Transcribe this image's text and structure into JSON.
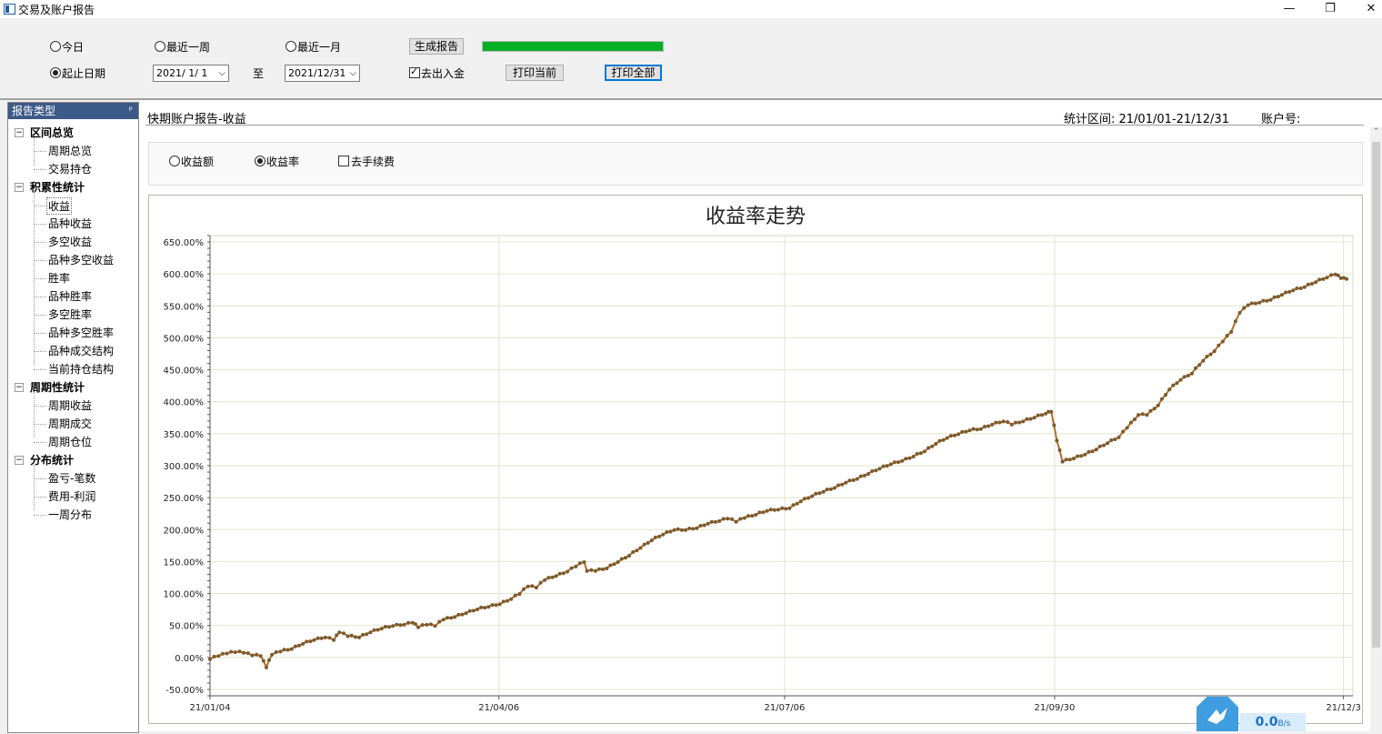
{
  "window": {
    "title": "交易及账户报告",
    "controls": {
      "minimize": "—",
      "restore": "❐",
      "close": "✕"
    }
  },
  "toolbar": {
    "range_today": "今日",
    "range_week": "最近一周",
    "range_month": "最近一月",
    "range_custom": "起止日期",
    "selected_range": "起止日期",
    "start_date": "2021/ 1/ 1",
    "to_label": "至",
    "end_date": "2021/12/31",
    "generate_label": "生成报告",
    "remove_deposit_label": "去出入金",
    "remove_deposit_checked": true,
    "print_current_label": "打印当前",
    "print_all_label": "打印全部",
    "progress": 1.0
  },
  "tree": {
    "header": "报告类型",
    "pin": "ᵖ",
    "groups": [
      {
        "label": "区间总览",
        "items": [
          "周期总览",
          "交易持仓"
        ]
      },
      {
        "label": "积累性统计",
        "items": [
          "收益",
          "品种收益",
          "多空收益",
          "品种多空收益",
          "胜率",
          "品种胜率",
          "多空胜率",
          "品种多空胜率",
          "品种成交结构",
          "当前持仓结构"
        ]
      },
      {
        "label": "周期性统计",
        "items": [
          "周期收益",
          "周期成交",
          "周期仓位"
        ]
      },
      {
        "label": "分布统计",
        "items": [
          "盈亏-笔数",
          "费用-利润",
          "一周分布"
        ]
      }
    ],
    "selected": "收益"
  },
  "report": {
    "title": "快期账户报告-收益",
    "period": "统计区间: 21/01/01-21/12/31",
    "account": "账户号:",
    "opt_amount": "收益额",
    "opt_rate": "收益率",
    "opt_fee": "去手续费",
    "selected_option": "收益率",
    "fee_checked": false
  },
  "net": {
    "speed": "0.0",
    "unit": "B/s"
  },
  "chart_data": {
    "type": "line",
    "title": "收益率走势",
    "ylim": [
      -60,
      660
    ],
    "yticks": [
      "650.00%",
      "600.00%",
      "550.00%",
      "500.00%",
      "450.00%",
      "400.00%",
      "350.00%",
      "300.00%",
      "250.00%",
      "200.00%",
      "150.00%",
      "100.00%",
      "50.00%",
      "0.00%",
      "-50.00%"
    ],
    "ytick_values": [
      650,
      600,
      550,
      500,
      450,
      400,
      350,
      300,
      250,
      200,
      150,
      100,
      50,
      0,
      -50
    ],
    "xticks": [
      "21/01/04",
      "21/04/06",
      "21/07/06",
      "21/09/30",
      "21/12/3"
    ],
    "xtick_days": [
      3,
      95,
      186,
      272,
      364
    ],
    "xlim": [
      3,
      367
    ],
    "grid": true,
    "line_color": "#b06d2f",
    "marker_color": "#7d5a2c",
    "series": [
      {
        "values_anchor": [
          [
            3,
            -2
          ],
          [
            6,
            3
          ],
          [
            9,
            7
          ],
          [
            12,
            9
          ],
          [
            15,
            8
          ],
          [
            18,
            4
          ],
          [
            21,
            3
          ],
          [
            23,
            -15
          ],
          [
            25,
            5
          ],
          [
            28,
            10
          ],
          [
            32,
            14
          ],
          [
            36,
            22
          ],
          [
            40,
            28
          ],
          [
            44,
            32
          ],
          [
            47,
            28
          ],
          [
            49,
            40
          ],
          [
            52,
            34
          ],
          [
            56,
            32
          ],
          [
            60,
            40
          ],
          [
            64,
            46
          ],
          [
            68,
            50
          ],
          [
            72,
            52
          ],
          [
            75,
            55
          ],
          [
            77,
            48
          ],
          [
            80,
            52
          ],
          [
            83,
            50
          ],
          [
            86,
            60
          ],
          [
            90,
            64
          ],
          [
            94,
            70
          ],
          [
            98,
            76
          ],
          [
            102,
            80
          ],
          [
            106,
            84
          ],
          [
            110,
            92
          ],
          [
            113,
            100
          ],
          [
            116,
            112
          ],
          [
            119,
            110
          ],
          [
            122,
            122
          ],
          [
            126,
            128
          ],
          [
            130,
            135
          ],
          [
            133,
            143
          ],
          [
            136,
            150
          ],
          [
            137,
            136
          ],
          [
            140,
            136
          ],
          [
            144,
            140
          ],
          [
            148,
            150
          ],
          [
            152,
            160
          ],
          [
            156,
            172
          ],
          [
            160,
            184
          ],
          [
            164,
            193
          ],
          [
            168,
            200
          ],
          [
            172,
            200
          ],
          [
            176,
            203
          ],
          [
            180,
            210
          ],
          [
            184,
            214
          ],
          [
            187,
            218
          ],
          [
            190,
            213
          ],
          [
            193,
            219
          ],
          [
            197,
            224
          ],
          [
            201,
            230
          ],
          [
            205,
            232
          ],
          [
            209,
            234
          ],
          [
            213,
            245
          ],
          [
            217,
            253
          ],
          [
            221,
            260
          ],
          [
            225,
            266
          ],
          [
            229,
            274
          ],
          [
            233,
            280
          ],
          [
            237,
            288
          ],
          [
            241,
            296
          ],
          [
            245,
            303
          ],
          [
            249,
            308
          ],
          [
            253,
            315
          ],
          [
            257,
            323
          ],
          [
            261,
            335
          ],
          [
            265,
            344
          ],
          [
            269,
            350
          ],
          [
            273,
            356
          ],
          [
            277,
            358
          ],
          [
            281,
            365
          ],
          [
            285,
            370
          ],
          [
            288,
            365
          ],
          [
            292,
            370
          ],
          [
            296,
            376
          ],
          [
            300,
            382
          ],
          [
            302,
            385
          ],
          [
            304,
            340
          ],
          [
            306,
            307
          ],
          [
            310,
            312
          ],
          [
            314,
            318
          ],
          [
            318,
            326
          ],
          [
            322,
            336
          ],
          [
            326,
            345
          ],
          [
            329,
            360
          ],
          [
            333,
            380
          ],
          [
            336,
            380
          ],
          [
            340,
            395
          ],
          [
            344,
            420
          ],
          [
            348,
            435
          ],
          [
            352,
            445
          ],
          [
            356,
            465
          ],
          [
            360,
            480
          ],
          [
            363,
            495
          ],
          [
            366,
            510
          ],
          [
            369,
            540
          ],
          [
            372,
            552
          ],
          [
            376,
            556
          ],
          [
            380,
            560
          ],
          [
            384,
            568
          ],
          [
            388,
            575
          ],
          [
            392,
            580
          ],
          [
            396,
            588
          ],
          [
            400,
            595
          ],
          [
            403,
            600
          ],
          [
            405,
            594
          ],
          [
            407,
            592
          ]
        ]
      }
    ]
  }
}
